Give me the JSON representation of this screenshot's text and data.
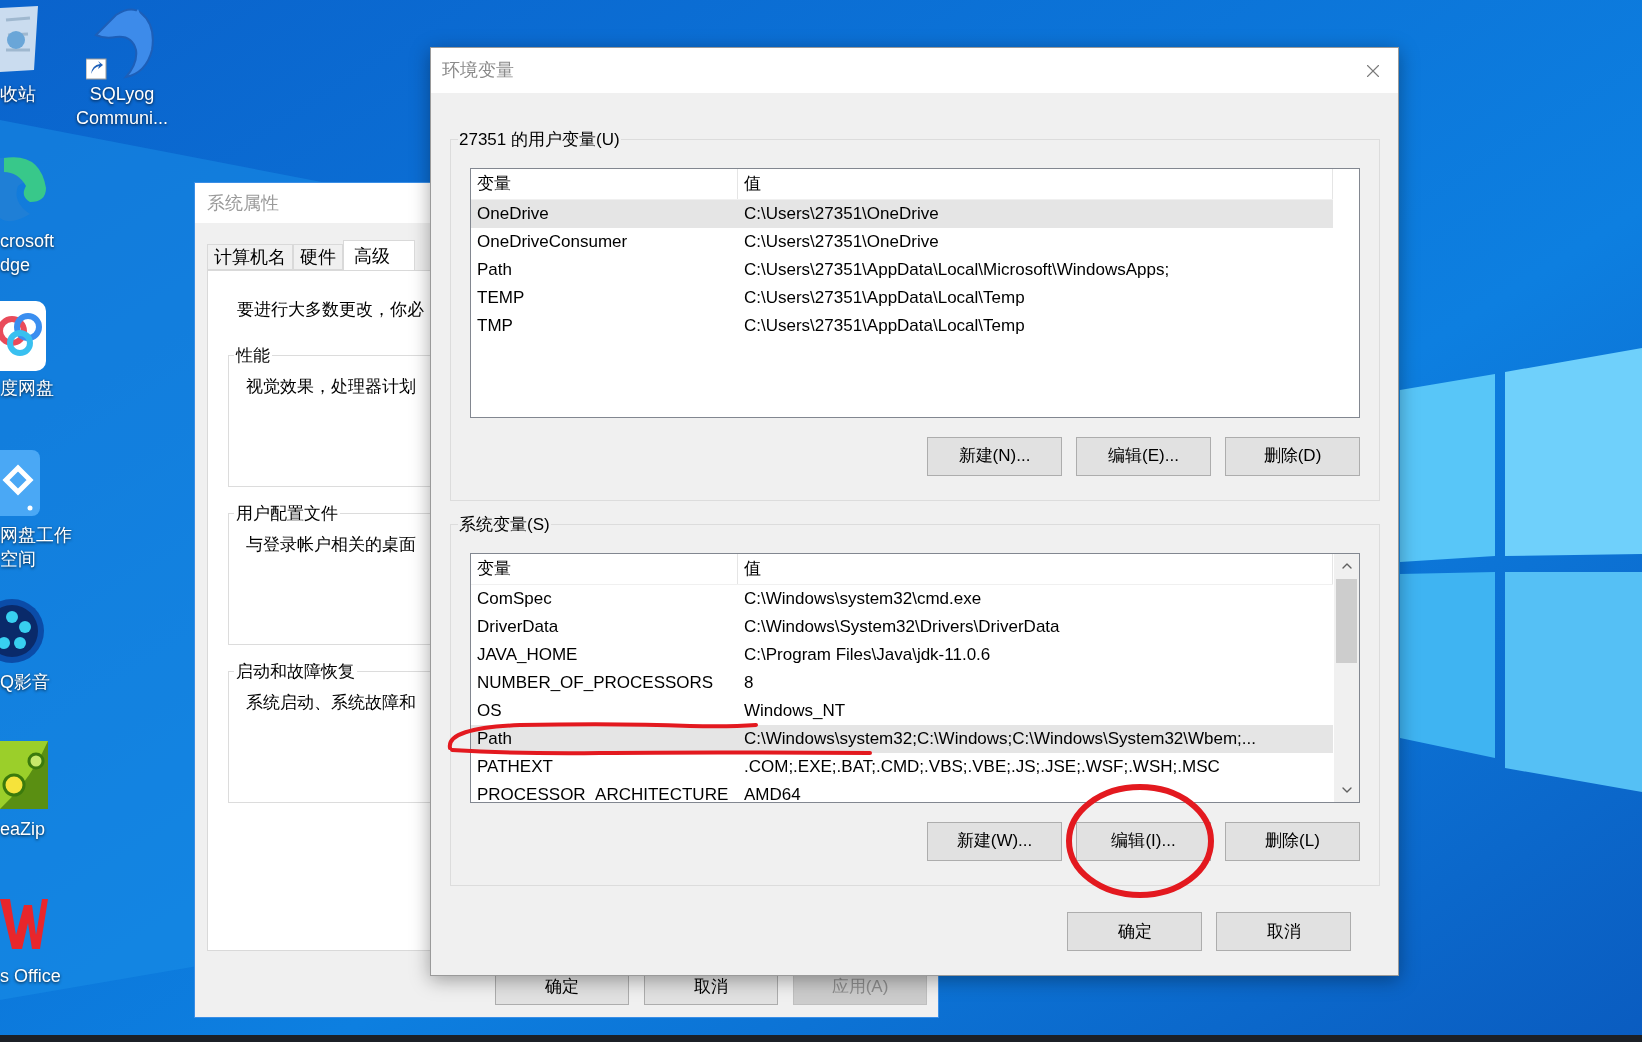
{
  "desktop_icons": [
    {
      "kind": "recycle",
      "lines": [
        "收站"
      ]
    },
    {
      "kind": "dolphin",
      "lines": [
        "SQLyog",
        "Communi..."
      ]
    },
    {
      "kind": "edge",
      "lines": [
        "crosoft",
        "dge"
      ]
    },
    {
      "kind": "cloud",
      "lines": [
        "度网盘"
      ]
    },
    {
      "kind": "workspace",
      "lines": [
        "网盘工作",
        "空间"
      ]
    },
    {
      "kind": "player",
      "lines": [
        "Q影音"
      ]
    },
    {
      "kind": "pea",
      "lines": [
        "eaZip"
      ]
    },
    {
      "kind": "wps",
      "lines": [
        "s Office"
      ]
    }
  ],
  "system_properties": {
    "title": "系统属性",
    "tabs": [
      {
        "label": "计算机名",
        "selected": false
      },
      {
        "label": "硬件",
        "selected": false
      },
      {
        "label": "高级",
        "selected": true
      }
    ],
    "intro": "要进行大多数更改，你必",
    "groups": [
      {
        "title": "性能",
        "text": "视觉效果，处理器计划"
      },
      {
        "title": "用户配置文件",
        "text": "与登录帐户相关的桌面"
      },
      {
        "title": "启动和故障恢复",
        "text": "系统启动、系统故障和"
      }
    ],
    "buttons": [
      {
        "label": "确定",
        "disabled": false
      },
      {
        "label": "取消",
        "disabled": false
      },
      {
        "label": "应用(A)",
        "disabled": true
      }
    ]
  },
  "environment_variables": {
    "title": "环境变量",
    "user_variables": {
      "title": "27351 的用户变量(U)",
      "columns": [
        "变量",
        "值"
      ],
      "rows": [
        {
          "name": "OneDrive",
          "value": "C:\\Users\\27351\\OneDrive",
          "selected": true
        },
        {
          "name": "OneDriveConsumer",
          "value": "C:\\Users\\27351\\OneDrive",
          "selected": false
        },
        {
          "name": "Path",
          "value": "C:\\Users\\27351\\AppData\\Local\\Microsoft\\WindowsApps;",
          "selected": false
        },
        {
          "name": "TEMP",
          "value": "C:\\Users\\27351\\AppData\\Local\\Temp",
          "selected": false
        },
        {
          "name": "TMP",
          "value": "C:\\Users\\27351\\AppData\\Local\\Temp",
          "selected": false
        }
      ],
      "buttons": [
        "新建(N)...",
        "编辑(E)...",
        "删除(D)"
      ]
    },
    "system_variables": {
      "title": "系统变量(S)",
      "columns": [
        "变量",
        "值"
      ],
      "rows": [
        {
          "name": "ComSpec",
          "value": "C:\\Windows\\system32\\cmd.exe",
          "selected": false
        },
        {
          "name": "DriverData",
          "value": "C:\\Windows\\System32\\Drivers\\DriverData",
          "selected": false
        },
        {
          "name": "JAVA_HOME",
          "value": "C:\\Program Files\\Java\\jdk-11.0.6",
          "selected": false
        },
        {
          "name": "NUMBER_OF_PROCESSORS",
          "value": "8",
          "selected": false
        },
        {
          "name": "OS",
          "value": "Windows_NT",
          "selected": false
        },
        {
          "name": "Path",
          "value": "C:\\Windows\\system32;C:\\Windows;C:\\Windows\\System32\\Wbem;...",
          "selected": true
        },
        {
          "name": "PATHEXT",
          "value": ".COM;.EXE;.BAT;.CMD;.VBS;.VBE;.JS;.JSE;.WSF;.WSH;.MSC",
          "selected": false
        },
        {
          "name": "PROCESSOR_ARCHITECTURE",
          "value": "AMD64",
          "selected": false
        }
      ],
      "buttons": [
        "新建(W)...",
        "编辑(I)...",
        "删除(L)"
      ]
    },
    "buttons": [
      "确定",
      "取消"
    ]
  }
}
